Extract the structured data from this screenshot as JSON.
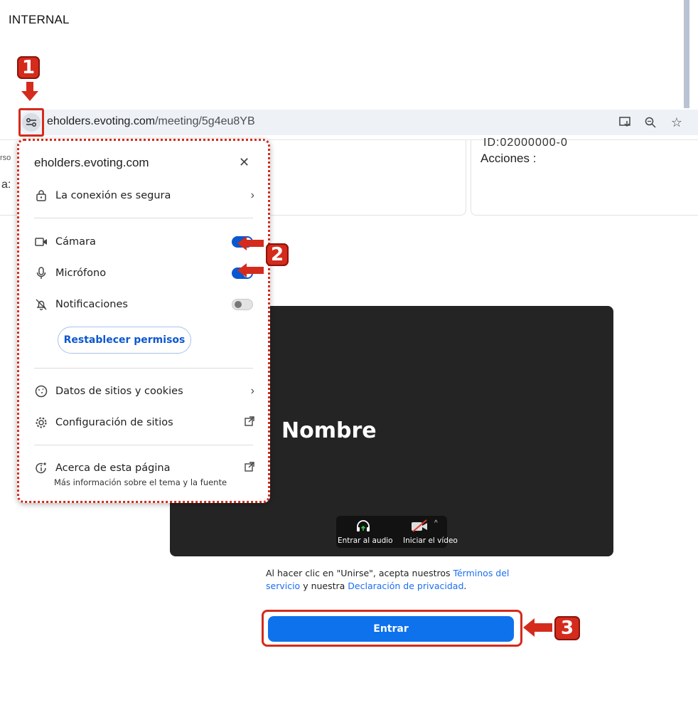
{
  "header": {
    "internal_label": "INTERNAL"
  },
  "address_bar": {
    "domain": "eholders.evoting.com",
    "path": "/meeting/5g4eu8YB",
    "icons": [
      "tune-icon",
      "install-icon",
      "zoom-icon",
      "bookmark-star-icon"
    ]
  },
  "background_page": {
    "id_line": "ID:02000000-0",
    "acciones_label": "Acciones :",
    "left_fragment_1": "rso",
    "left_fragment_2": "a:"
  },
  "popup": {
    "title": "eholders.evoting.com",
    "connection": "La conexión es segura",
    "camera": {
      "label": "Cámara",
      "enabled": true
    },
    "microphone": {
      "label": "Micrófono",
      "enabled": true
    },
    "notifications": {
      "label": "Notificaciones",
      "enabled": false
    },
    "reset_button": "Restablecer permisos",
    "site_data": "Datos de sitios y cookies",
    "site_settings": "Configuración de sitios",
    "about_title": "Acerca de esta página",
    "about_sub": "Más información sobre el tema y la fuente"
  },
  "meeting": {
    "name": "Nombre",
    "audio_label": "Entrar al audio",
    "video_label": "Iniciar el vídeo",
    "terms_prefix": "Al hacer clic en \"Unirse\", acepta nuestros ",
    "terms_link": "Términos del servicio",
    "terms_mid": " y nuestra ",
    "privacy_link": "Declaración de privacidad",
    "terms_suffix": ".",
    "join_button": "Entrar"
  },
  "steps": [
    "1",
    "2",
    "3"
  ],
  "colors": {
    "annotation": "#d42b1c",
    "toggle_on": "#0b57d0",
    "join": "#0e72ed",
    "preview_bg": "#242424"
  }
}
